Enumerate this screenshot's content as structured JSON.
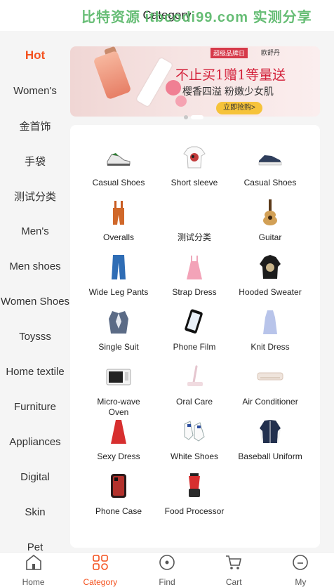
{
  "header": {
    "title": "Category",
    "watermark": "比特资源 itbcodi99.com 实测分享"
  },
  "sidebar": {
    "items": [
      {
        "label": "Hot",
        "active": true
      },
      {
        "label": "Women's"
      },
      {
        "label": "金首饰"
      },
      {
        "label": "手袋"
      },
      {
        "label": "测试分类"
      },
      {
        "label": "Men's"
      },
      {
        "label": "Men shoes"
      },
      {
        "label": "Women Shoes"
      },
      {
        "label": "Toysss"
      },
      {
        "label": "Home textile"
      },
      {
        "label": "Furniture"
      },
      {
        "label": "Appliances"
      },
      {
        "label": "Digital"
      },
      {
        "label": "Skin"
      },
      {
        "label": "Pet"
      }
    ]
  },
  "banner": {
    "badge": "超级品牌日",
    "brand": "欧舒丹",
    "headline": "不止买1赠1等量送",
    "subline": "樱香四溢 粉嫩少女肌",
    "cta": "立即抢购>"
  },
  "products": [
    {
      "label": "Casual Shoes",
      "icon": "sneaker-icon"
    },
    {
      "label": "Short sleeve",
      "icon": "tshirt-icon"
    },
    {
      "label": "Casual Shoes",
      "icon": "canvas-shoe-icon"
    },
    {
      "label": "Overalls",
      "icon": "overalls-icon"
    },
    {
      "label": "测试分类",
      "icon": ""
    },
    {
      "label": "Guitar",
      "icon": "guitar-icon"
    },
    {
      "label": "Wide Leg Pants",
      "icon": "pants-icon"
    },
    {
      "label": "Strap Dress",
      "icon": "strap-dress-icon"
    },
    {
      "label": "Hooded Sweater",
      "icon": "hoodie-icon"
    },
    {
      "label": "Single Suit",
      "icon": "suit-icon"
    },
    {
      "label": "Phone Film",
      "icon": "phone-film-icon"
    },
    {
      "label": "Knit Dress",
      "icon": "knit-dress-icon"
    },
    {
      "label": "Micro-wave Oven",
      "icon": "microwave-icon"
    },
    {
      "label": "Oral Care",
      "icon": "toothbrush-icon"
    },
    {
      "label": "Air Conditioner",
      "icon": "air-conditioner-icon"
    },
    {
      "label": "Sexy Dress",
      "icon": "red-dress-icon"
    },
    {
      "label": "White Shoes",
      "icon": "white-shoes-icon"
    },
    {
      "label": "Baseball Uniform",
      "icon": "jacket-icon"
    },
    {
      "label": "Phone Case",
      "icon": "phone-case-icon"
    },
    {
      "label": "Food Processor",
      "icon": "blender-icon"
    }
  ],
  "tabbar": {
    "tabs": [
      {
        "label": "Home",
        "icon": "home-icon"
      },
      {
        "label": "Category",
        "icon": "category-icon",
        "active": true
      },
      {
        "label": "Find",
        "icon": "compass-icon"
      },
      {
        "label": "Cart",
        "icon": "cart-icon"
      },
      {
        "label": "My",
        "icon": "user-icon"
      }
    ]
  },
  "colors": {
    "accent": "#f4511e",
    "watermark": "#5ab86a"
  }
}
